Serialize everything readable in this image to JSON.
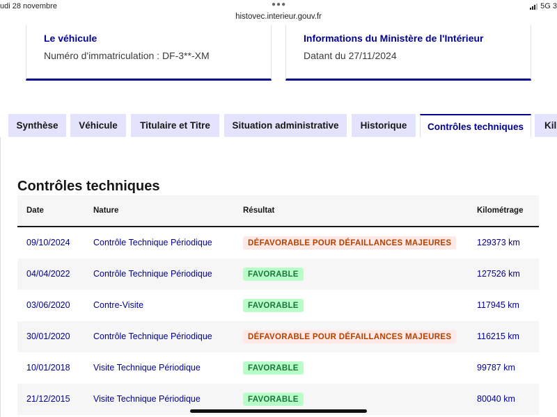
{
  "status_bar": {
    "time": "udi 28 novembre",
    "url": "histovec.interieur.gouv.fr",
    "network": "5G 3"
  },
  "cards": {
    "vehicle": {
      "title": "Le véhicule",
      "text": "Numéro d'immatriculation : DF-3**-XM"
    },
    "ministry": {
      "title": "Informations du Ministère de l'Intérieur",
      "text": "Datant du 27/11/2024"
    }
  },
  "tabs": [
    {
      "label": "Synthèse",
      "active": false
    },
    {
      "label": "Véhicule",
      "active": false
    },
    {
      "label": "Titulaire et Titre",
      "active": false
    },
    {
      "label": "Situation administrative",
      "active": false
    },
    {
      "label": "Historique",
      "active": false
    },
    {
      "label": "Contrôles techniques",
      "active": true
    },
    {
      "label": "Kil",
      "active": false
    }
  ],
  "section": {
    "title": "Contrôles techniques"
  },
  "table": {
    "headers": {
      "date": "Date",
      "nature": "Nature",
      "result": "Résultat",
      "mileage": "Kilométrage"
    },
    "rows": [
      {
        "date": "09/10/2024",
        "nature": "Contrôle Technique Périodique",
        "result": "DÉFAVORABLE POUR DÉFAILLANCES MAJEURES",
        "status": "unfavorable",
        "mileage": "129373 km"
      },
      {
        "date": "04/04/2022",
        "nature": "Contrôle Technique Périodique",
        "result": "FAVORABLE",
        "status": "favorable",
        "mileage": "127526 km"
      },
      {
        "date": "03/06/2020",
        "nature": "Contre-Visite",
        "result": "FAVORABLE",
        "status": "favorable",
        "mileage": "117945 km"
      },
      {
        "date": "30/01/2020",
        "nature": "Contrôle Technique Périodique",
        "result": "DÉFAVORABLE POUR DÉFAILLANCES MAJEURES",
        "status": "unfavorable",
        "mileage": "116215 km"
      },
      {
        "date": "10/01/2018",
        "nature": "Visite Technique Périodique",
        "result": "FAVORABLE",
        "status": "favorable",
        "mileage": "99787 km"
      },
      {
        "date": "21/12/2015",
        "nature": "Visite Technique Périodique",
        "result": "FAVORABLE",
        "status": "favorable",
        "mileage": "80040 km"
      }
    ]
  },
  "colors": {
    "brand_blue": "#000091",
    "tab_bg": "#e3e3fd",
    "favorable_bg": "#b8fec9",
    "favorable_text": "#18753c",
    "unfavorable_bg": "#ffe9e6",
    "unfavorable_text": "#b34000"
  }
}
